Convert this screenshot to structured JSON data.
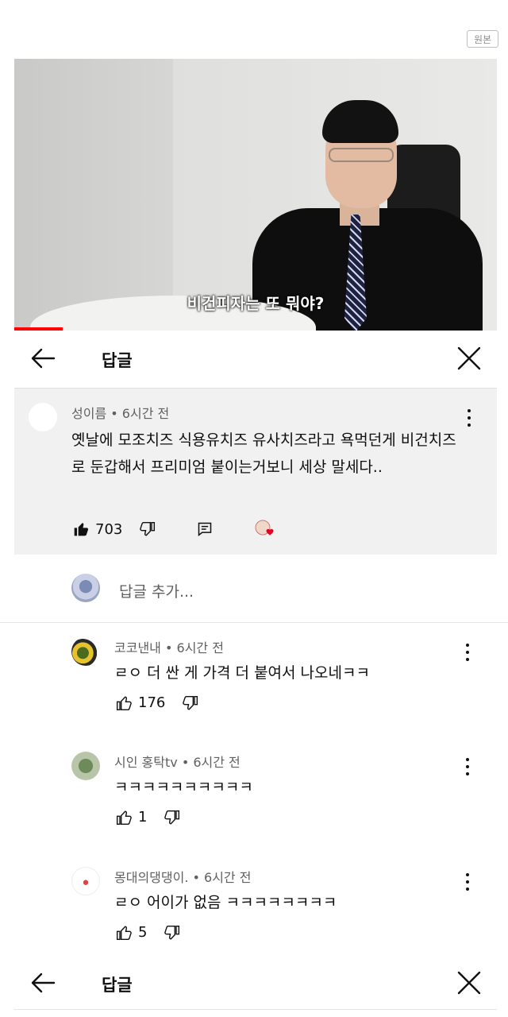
{
  "badge": "원본",
  "video": {
    "subtitle": "비건피자는 또 뭐야?",
    "progress": 0.1
  },
  "header": {
    "title": "답글"
  },
  "top_comment": {
    "author": "성이름",
    "time": "6시간 전",
    "text": "옛날에 모조치즈 식용유치즈 유사치즈라고 욕먹던게 비건치즈로 둔갑해서 프리미엄 붙이는거보니 세상 말세다..",
    "likes": "703"
  },
  "add_reply": {
    "placeholder": "답글 추가..."
  },
  "replies": [
    {
      "author": "코코낸내",
      "time": "6시간 전",
      "text": "ㄹㅇ 더 싼 게 가격 더 붙여서 나오네ㅋㅋ",
      "likes": "176"
    },
    {
      "author": "시인 홍탁tv",
      "time": "6시간 전",
      "text": "ㅋㅋㅋㅋㅋㅋㅋㅋㅋㅋ",
      "likes": "1"
    },
    {
      "author": "몽대의댕댕이.",
      "time": "6시간 전",
      "text": "ㄹㅇ 어이가 없음 ㅋㅋㅋㅋㅋㅋㅋㅋ",
      "likes": "5"
    }
  ],
  "separator": "•",
  "icons": {
    "back": "arrow-left-icon",
    "close": "close-x-icon",
    "like": "thumbs-up-icon",
    "dislike": "thumbs-down-icon",
    "reply": "reply-comment-icon",
    "heart": "creator-heart-icon",
    "more": "kebab-menu-icon"
  },
  "colors": {
    "accent": "#ff0000",
    "meta_text": "#606060",
    "comment_bg": "#f1f1f1"
  }
}
